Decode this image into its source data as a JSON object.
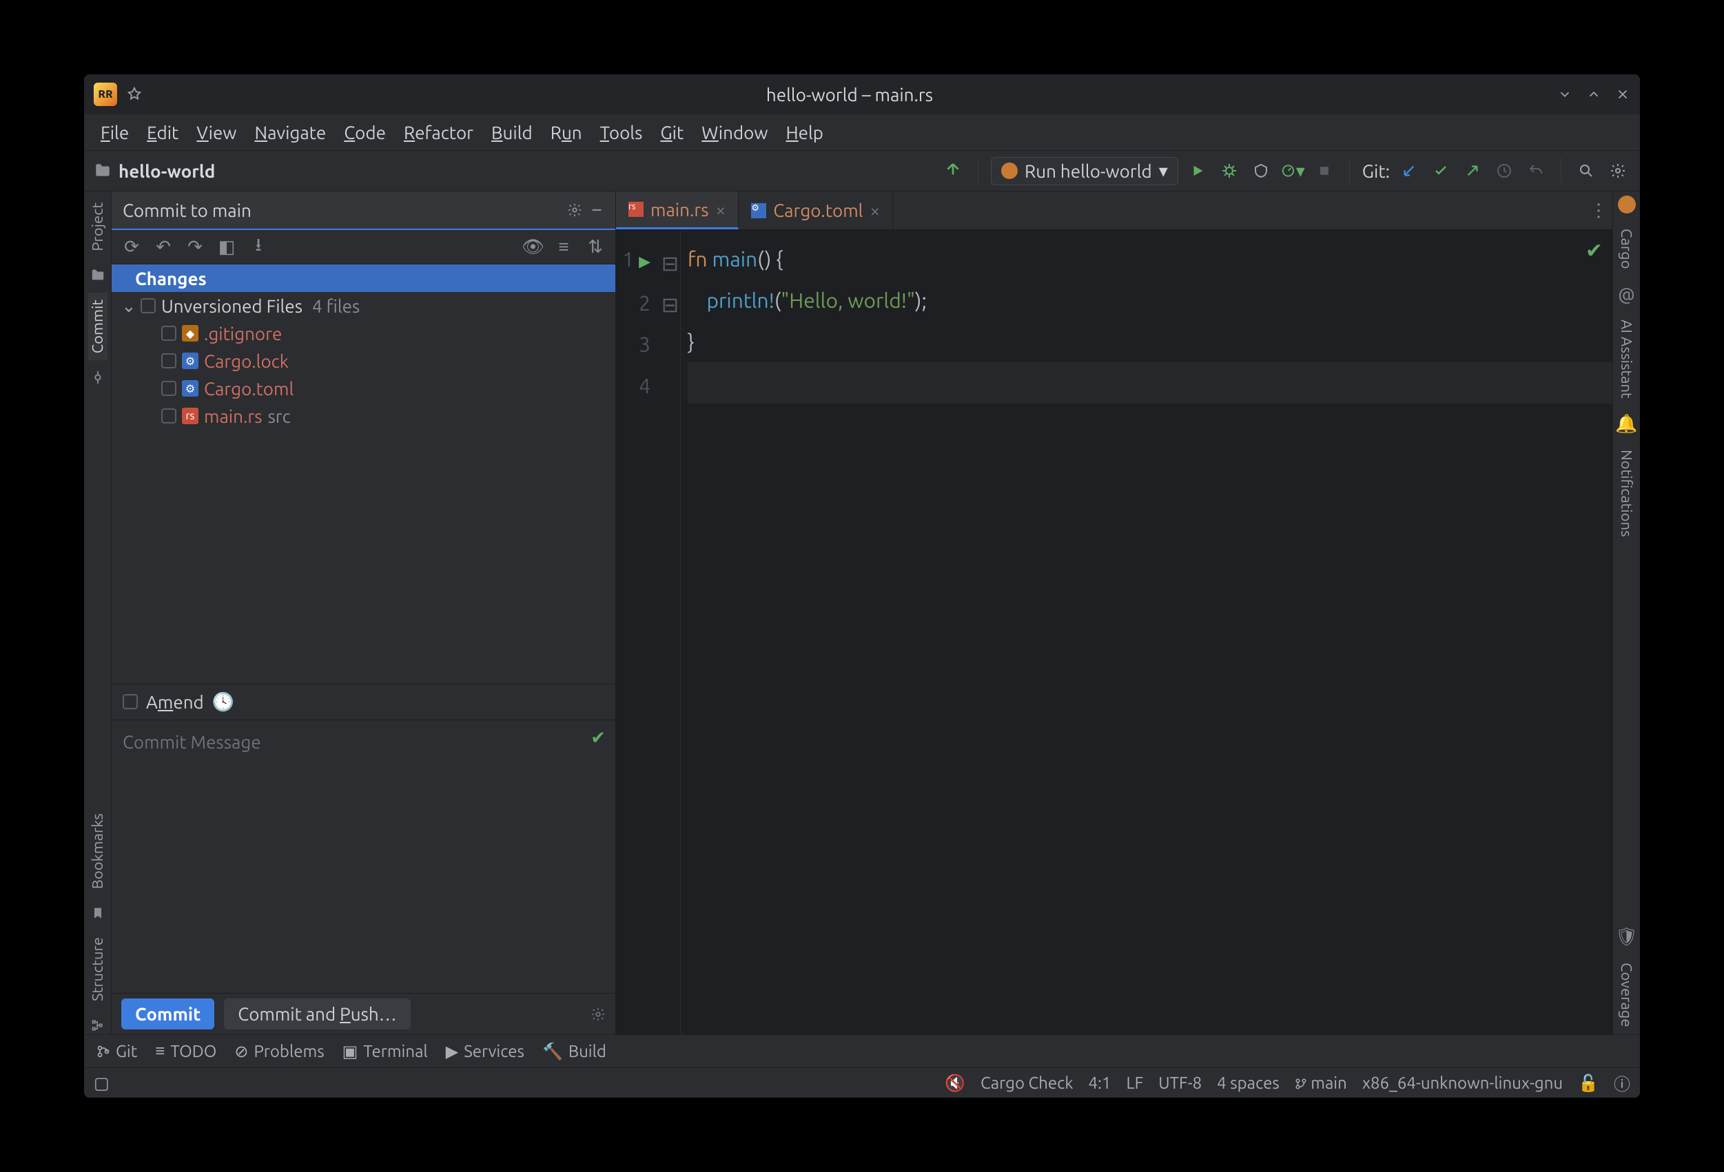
{
  "window": {
    "title": "hello-world – main.rs"
  },
  "menubar": [
    "File",
    "Edit",
    "View",
    "Navigate",
    "Code",
    "Refactor",
    "Build",
    "Run",
    "Tools",
    "Git",
    "Window",
    "Help"
  ],
  "breadcrumb": {
    "project": "hello-world"
  },
  "toolbar": {
    "git_label": "Git:",
    "run_config": "Run hello-world"
  },
  "left_tools": {
    "project": "Project",
    "commit": "Commit",
    "bookmarks": "Bookmarks",
    "structure": "Structure"
  },
  "right_tools": {
    "cargo": "Cargo",
    "ai": "AI Assistant",
    "notifications": "Notifications",
    "coverage": "Coverage"
  },
  "commit_panel": {
    "header": "Commit to main",
    "changes_label": "Changes",
    "unversioned_label": "Unversioned Files",
    "unversioned_count": "4 files",
    "files": [
      {
        "name": ".gitignore",
        "icon": "git",
        "suffix": ""
      },
      {
        "name": "Cargo.lock",
        "icon": "toml",
        "suffix": ""
      },
      {
        "name": "Cargo.toml",
        "icon": "toml",
        "suffix": ""
      },
      {
        "name": "main.rs",
        "icon": "rs",
        "suffix": "src"
      }
    ],
    "amend_label": "Amend",
    "msg_placeholder": "Commit Message",
    "commit_btn": "Commit",
    "commit_push_btn": "Commit and Push…"
  },
  "tabs": [
    {
      "name": "main.rs",
      "icon": "rs",
      "active": true
    },
    {
      "name": "Cargo.toml",
      "icon": "toml",
      "active": false
    }
  ],
  "code": {
    "lines": [
      "1",
      "2",
      "3",
      "4"
    ],
    "l1_kw": "fn ",
    "l1_fn": "main",
    "l1_rest": "() {",
    "l2_indent": "    ",
    "l2_mac": "println!",
    "l2_paren_o": "(",
    "l2_str": "\"Hello, world!\"",
    "l2_paren_c": ");",
    "l3": "}"
  },
  "bottombar": {
    "git": "Git",
    "todo": "TODO",
    "problems": "Problems",
    "terminal": "Terminal",
    "services": "Services",
    "build": "Build"
  },
  "statusbar": {
    "cargo": "Cargo Check",
    "pos": "4:1",
    "le": "LF",
    "enc": "UTF-8",
    "indent": "4 spaces",
    "branch": "main",
    "target": "x86_64-unknown-linux-gnu"
  }
}
